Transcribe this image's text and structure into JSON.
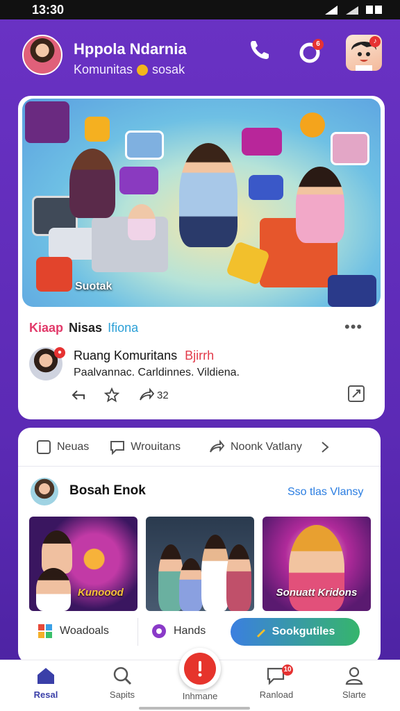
{
  "status_bar": {
    "time": "13:30",
    "icons": [
      "signal-icon",
      "wifi-icon",
      "battery-icon"
    ]
  },
  "header": {
    "title": "Hppola Ndarnia",
    "subtitle": "Komunitas",
    "subtitle_suffix": "sosak",
    "actions": [
      "phone-icon",
      "notification-icon",
      "profile-avatar"
    ]
  },
  "post_card": {
    "hero_caption": "Suotak",
    "tags": [
      "Kiaap",
      "Nisas",
      "Ifiona"
    ],
    "author_name": "Ruang Komuritans",
    "author_tag": "Bjirrh",
    "description": "Paalvannac. Carldinnes. Vildiena.",
    "share_count": "32",
    "more": "•••"
  },
  "feed_card": {
    "tabs": [
      {
        "label": "Neuas",
        "icon": "square-icon"
      },
      {
        "label": "Wrouitans",
        "icon": "chat-icon"
      },
      {
        "label": "Noonk Vatlany",
        "icon": "share-icon"
      }
    ],
    "section_title": "Bosah Enok",
    "section_link": "Sso tlas Vlansy",
    "thumbnails": [
      {
        "caption": "Kunoood",
        "bg": "#3a1660"
      },
      {
        "caption": "",
        "bg": "#2a3a4e"
      },
      {
        "caption": "Sonuatt Kridons",
        "bg": "#5a1a70"
      }
    ],
    "chips": [
      {
        "label": "Woadoals",
        "icon": "apps-icon"
      },
      {
        "label": "Hands",
        "icon": "record-icon"
      }
    ],
    "cta_label": "Sookgutiles"
  },
  "bottom_nav": [
    {
      "label": "Resal",
      "icon": "home-icon"
    },
    {
      "label": "Sapits",
      "icon": "search-icon"
    },
    {
      "label": "Inhmane",
      "icon": "alert-icon"
    },
    {
      "label": "Ranload",
      "icon": "chat-bubble-icon",
      "badge": "10"
    },
    {
      "label": "Slarte",
      "icon": "user-icon"
    }
  ],
  "colors": {
    "brand": "#5c2ab5",
    "accent": "#e6342c",
    "link": "#2a7de1",
    "active_nav": "#3a3fa8"
  }
}
